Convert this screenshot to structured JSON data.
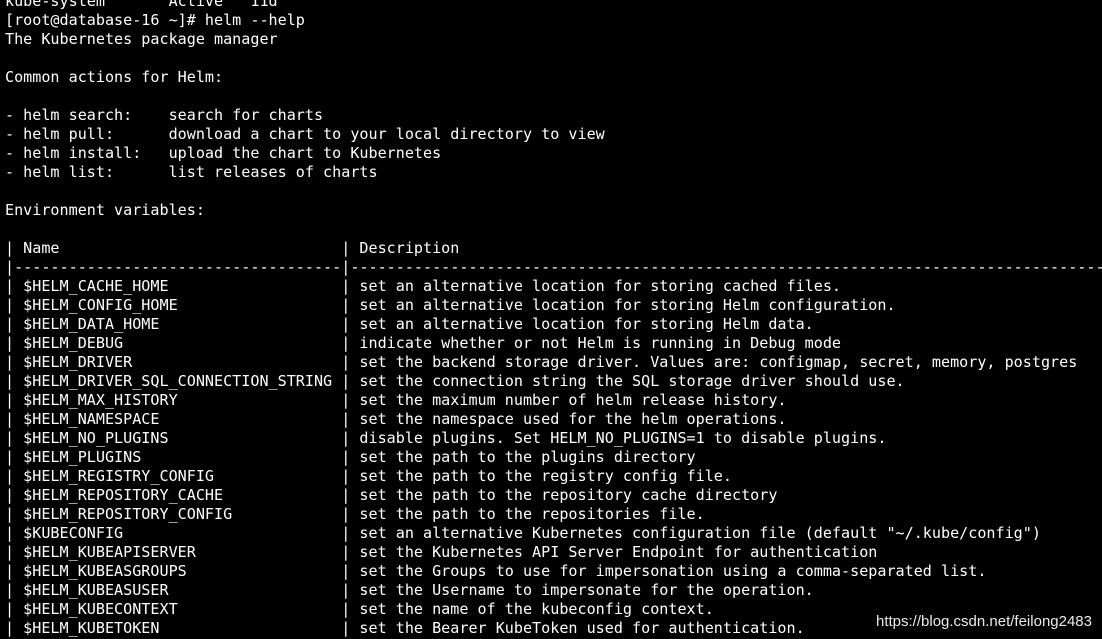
{
  "colors": {
    "background": "#000000",
    "foreground": "#ffffff"
  },
  "terminal": {
    "lines": [
      "kube-system       Active   11d",
      "[root@database-16 ~]# helm --help",
      "The Kubernetes package manager",
      "",
      "Common actions for Helm:",
      "",
      "- helm search:    search for charts",
      "- helm pull:      download a chart to your local directory to view",
      "- helm install:   upload the chart to Kubernetes",
      "- helm list:      list releases of charts",
      "",
      "Environment variables:",
      "",
      "| Name                               | Description                                                                       |",
      "|------------------------------------|-----------------------------------------------------------------------------------|",
      "| $HELM_CACHE_HOME                   | set an alternative location for storing cached files.                             |",
      "| $HELM_CONFIG_HOME                  | set an alternative location for storing Helm configuration.                       |",
      "| $HELM_DATA_HOME                    | set an alternative location for storing Helm data.                                |",
      "| $HELM_DEBUG                        | indicate whether or not Helm is running in Debug mode                             |",
      "| $HELM_DRIVER                       | set the backend storage driver. Values are: configmap, secret, memory, postgres   |",
      "| $HELM_DRIVER_SQL_CONNECTION_STRING | set the connection string the SQL storage driver should use.                      |",
      "| $HELM_MAX_HISTORY                  | set the maximum number of helm release history.                                   |",
      "| $HELM_NAMESPACE                    | set the namespace used for the helm operations.                                   |",
      "| $HELM_NO_PLUGINS                   | disable plugins. Set HELM_NO_PLUGINS=1 to disable plugins.                        |",
      "| $HELM_PLUGINS                      | set the path to the plugins directory                                             |",
      "| $HELM_REGISTRY_CONFIG              | set the path to the registry config file.                                         |",
      "| $HELM_REPOSITORY_CACHE             | set the path to the repository cache directory                                    |",
      "| $HELM_REPOSITORY_CONFIG            | set the path to the repositories file.                                            |",
      "| $KUBECONFIG                        | set an alternative Kubernetes configuration file (default \"~/.kube/config\")       |",
      "| $HELM_KUBEAPISERVER                | set the Kubernetes API Server Endpoint for authentication                         |",
      "| $HELM_KUBEASGROUPS                 | set the Groups to use for impersonation using a comma-separated list.             |",
      "| $HELM_KUBEASUSER                   | set the Username to impersonate for the operation.                                |",
      "| $HELM_KUBECONTEXT                  | set the name of the kubeconfig context.                                           |",
      "| $HELM_KUBETOKEN                    | set the Bearer KubeToken used for authentication.                                 |"
    ]
  },
  "watermark": "https://blog.csdn.net/feilong2483"
}
